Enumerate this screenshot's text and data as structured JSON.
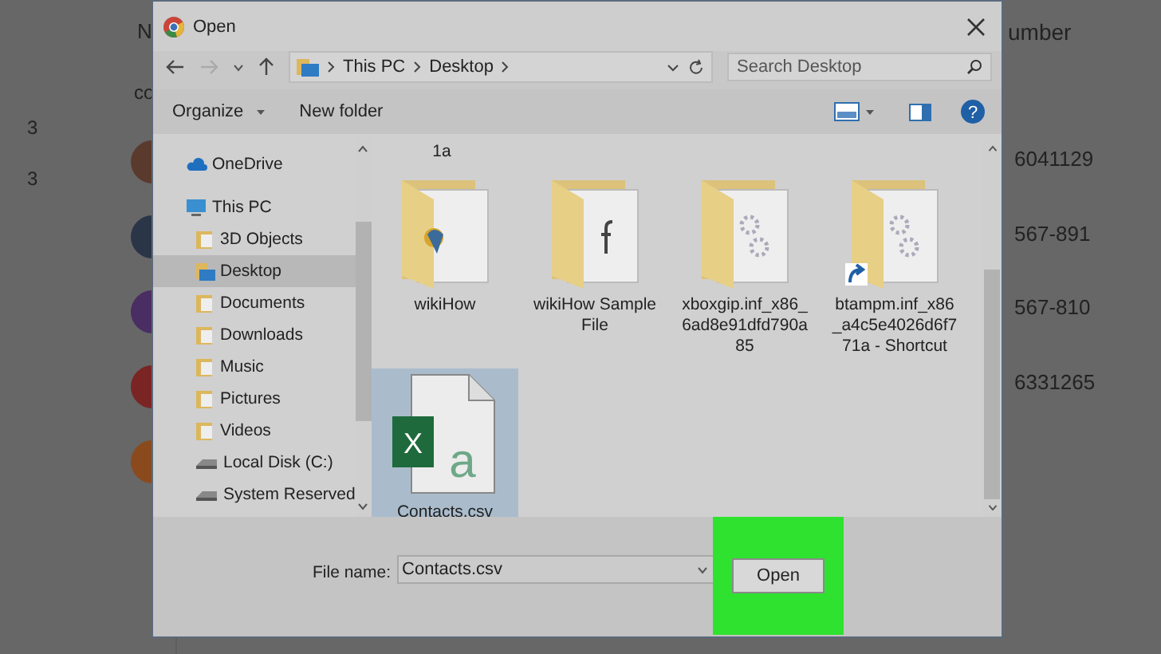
{
  "background_app": {
    "header_left": "N",
    "header_right": "umber",
    "subheader": "co",
    "left_counts": [
      "3",
      "3"
    ],
    "avatars": [
      {
        "color": "#5b3a2e"
      },
      {
        "color": "#2b3548"
      },
      {
        "color": "#4a2d63"
      },
      {
        "color": "#7a2424"
      },
      {
        "color": "#8a4a1e"
      }
    ],
    "phone_numbers": [
      "6041129",
      "567-891",
      "567-810",
      "6331265"
    ]
  },
  "dialog": {
    "title": "Open",
    "address": {
      "crumbs": [
        "This PC",
        "Desktop"
      ]
    },
    "search": {
      "placeholder": "Search Desktop"
    },
    "toolbar": {
      "organize": "Organize",
      "new_folder": "New folder",
      "help": "?"
    },
    "nav": [
      {
        "label": "OneDrive",
        "kind": "cloud",
        "selected": false
      },
      {
        "label": "This PC",
        "kind": "pc",
        "selected": false,
        "children": [
          {
            "label": "3D Objects",
            "kind": "folder",
            "selected": false
          },
          {
            "label": "Desktop",
            "kind": "desktop",
            "selected": true
          },
          {
            "label": "Documents",
            "kind": "folder",
            "selected": false
          },
          {
            "label": "Downloads",
            "kind": "folder",
            "selected": false
          },
          {
            "label": "Music",
            "kind": "folder",
            "selected": false
          },
          {
            "label": "Pictures",
            "kind": "folder",
            "selected": false
          },
          {
            "label": "Videos",
            "kind": "folder",
            "selected": false
          },
          {
            "label": "Local Disk (C:)",
            "kind": "drive",
            "selected": false
          },
          {
            "label": "System Reserved",
            "kind": "drive",
            "selected": false
          }
        ]
      }
    ],
    "files": [
      {
        "name": "1a",
        "kind": "label"
      },
      {
        "name": "wikiHow",
        "kind": "folder-logo",
        "selected": false,
        "shortcut": false
      },
      {
        "name": "wikiHow Sample File",
        "kind": "folder-letter",
        "selected": false,
        "shortcut": false
      },
      {
        "name": "xboxgip.inf_x86_6ad8e91dfd790a85",
        "kind": "folder-gear",
        "selected": false,
        "shortcut": false
      },
      {
        "name": "btampm.inf_x86_a4c5e4026d6f771a - Shortcut",
        "kind": "folder-gear",
        "selected": false,
        "shortcut": true
      },
      {
        "name": "Contacts.csv",
        "kind": "csv",
        "selected": true,
        "icon_letters": [
          "X",
          "a"
        ]
      }
    ],
    "file_name": {
      "label": "File name:",
      "value": "Contacts.csv"
    },
    "open_button": {
      "label": "Open",
      "highlighted": true
    }
  }
}
